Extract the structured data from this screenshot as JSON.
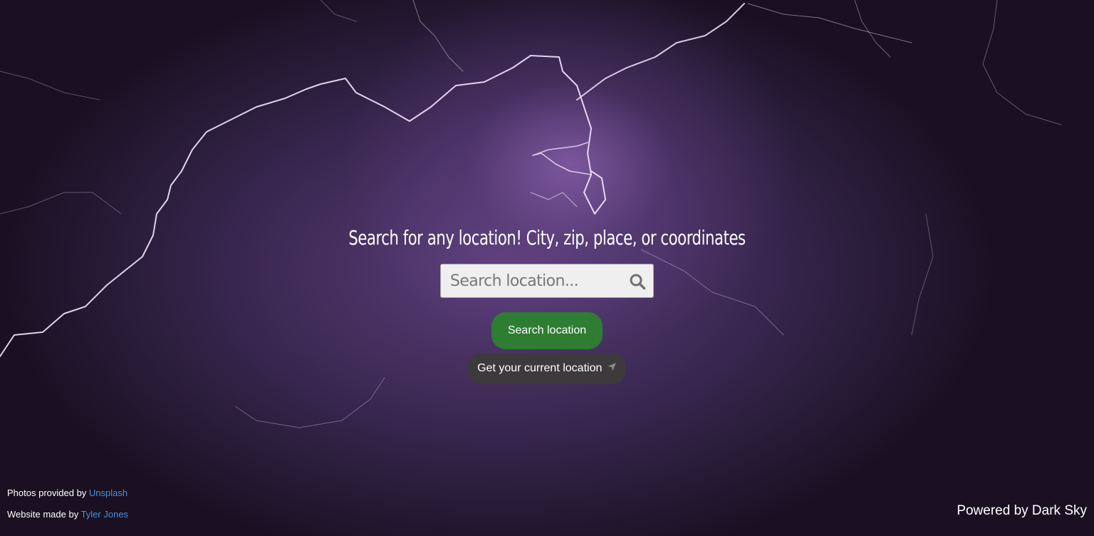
{
  "colors": {
    "primary_button": "#2e7d32",
    "secondary_button": "#3c3a3c",
    "link": "#4a90d9",
    "background": "#3e2a56"
  },
  "hero": {
    "headline": "Search for any location! City, zip, place, or coordinates"
  },
  "search": {
    "placeholder": "Search location...",
    "value": "",
    "icon": "search-icon"
  },
  "buttons": {
    "search_location": "Search location",
    "current_location": "Get your current location",
    "current_location_icon": "location-arrow-icon"
  },
  "footer": {
    "photos_prefix": "Photos provided by ",
    "photos_link": "Unsplash",
    "made_prefix": "Website made by ",
    "made_link": "Tyler Jones",
    "powered_by": "Powered by Dark Sky"
  }
}
